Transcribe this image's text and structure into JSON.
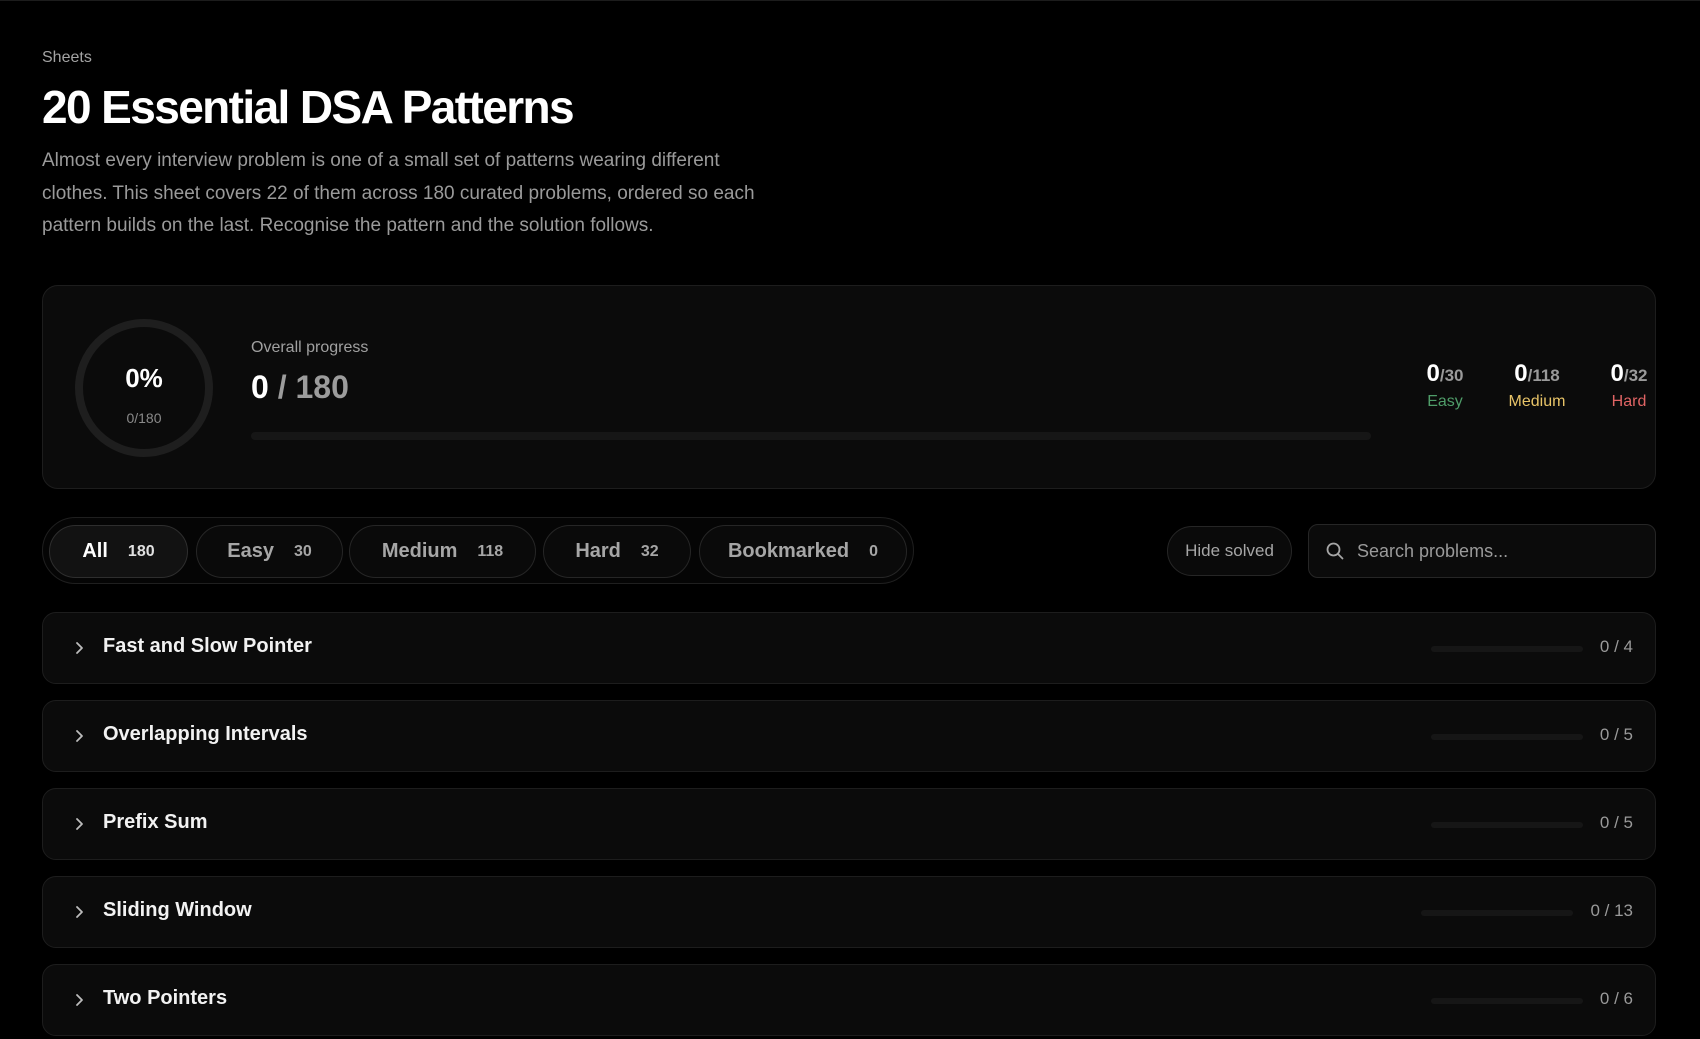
{
  "header": {
    "breadcrumb": "Sheets",
    "title": "20 Essential DSA Patterns",
    "description": "Almost every interview problem is one of a small set of patterns wearing different clothes. This sheet covers 22 of them across 180 curated problems, ordered so each pattern builds on the last. Recognise the pattern and the solution follows."
  },
  "progress": {
    "percent_text": "0%",
    "ring_sub": "0/180",
    "ring_fraction": 0,
    "overall_label": "Overall progress",
    "solved": "0",
    "separator": "/",
    "total": "180",
    "bar_fraction": 0,
    "difficulties": [
      {
        "solved": "0",
        "total": "/30",
        "label": "Easy",
        "color": "#4f9d69"
      },
      {
        "solved": "0",
        "total": "/118",
        "label": "Medium",
        "color": "#e8c468"
      },
      {
        "solved": "0",
        "total": "/32",
        "label": "Hard",
        "color": "#e06464"
      }
    ]
  },
  "filters": {
    "chips": [
      {
        "label": "All",
        "count": "180",
        "active": true
      },
      {
        "label": "Easy",
        "count": "30",
        "active": false
      },
      {
        "label": "Medium",
        "count": "118",
        "active": false
      },
      {
        "label": "Hard",
        "count": "32",
        "active": false
      },
      {
        "label": "Bookmarked",
        "count": "0",
        "active": false
      }
    ],
    "hide_solved_label": "Hide solved",
    "search_placeholder": "Search problems..."
  },
  "patterns": [
    {
      "name": "Fast and Slow Pointer",
      "count": "0 / 4",
      "fraction": 0
    },
    {
      "name": "Overlapping Intervals",
      "count": "0 / 5",
      "fraction": 0
    },
    {
      "name": "Prefix Sum",
      "count": "0 / 5",
      "fraction": 0
    },
    {
      "name": "Sliding Window",
      "count": "0 / 13",
      "fraction": 0
    },
    {
      "name": "Two Pointers",
      "count": "0 / 6",
      "fraction": 0
    }
  ]
}
